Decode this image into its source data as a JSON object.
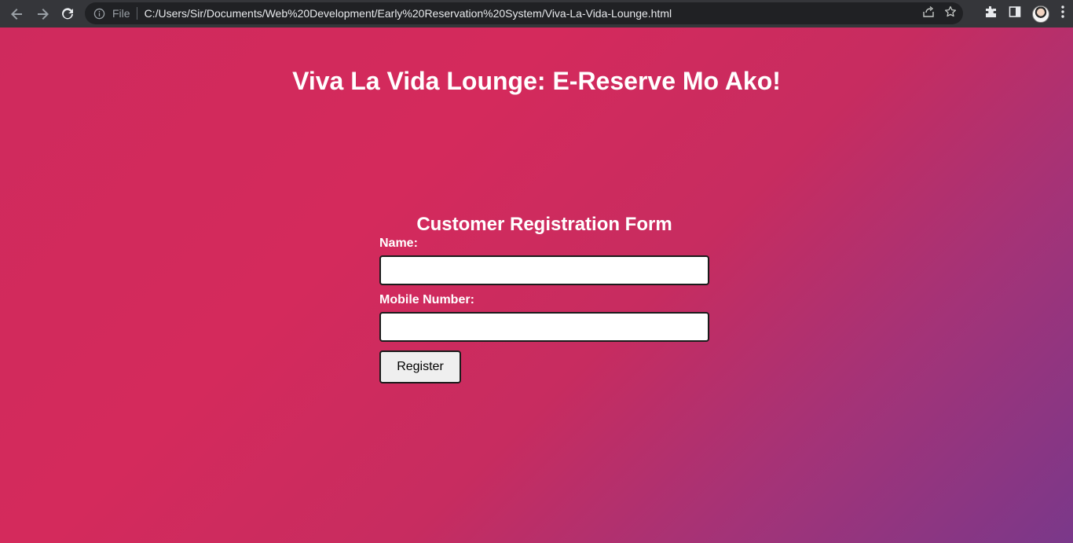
{
  "browser": {
    "file_label": "File",
    "url": "C:/Users/Sir/Documents/Web%20Development/Early%20Reservation%20System/Viva-La-Vida-Lounge.html",
    "icons": [
      "back-icon",
      "forward-icon",
      "reload-icon",
      "info-icon",
      "share-icon",
      "star-icon",
      "extensions-icon",
      "side-panel-icon",
      "avatar",
      "menu-icon"
    ]
  },
  "page": {
    "title": "Viva La Vida Lounge: E-Reserve Mo Ako!",
    "gradient_colors": [
      "#d42a5c",
      "#7a388a"
    ]
  },
  "form": {
    "title": "Customer Registration Form",
    "name_label": "Name:",
    "name_value": "",
    "mobile_label": "Mobile Number:",
    "mobile_value": "",
    "register_label": "Register"
  }
}
